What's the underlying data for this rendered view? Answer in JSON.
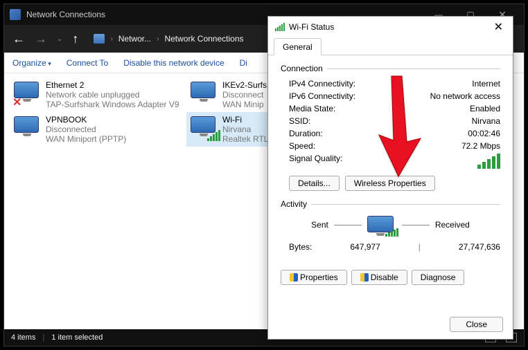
{
  "window": {
    "title": "Network Connections"
  },
  "breadcrumb": {
    "seg1": "Networ...",
    "seg2": "Network Connections"
  },
  "toolbar": {
    "organize": "Organize",
    "connect_to": "Connect To",
    "disable": "Disable this network device",
    "diagnose_label": "Di"
  },
  "connections": [
    {
      "name": "Ethernet 2",
      "status": "Network cable unplugged",
      "device": "TAP-Surfshark Windows Adapter V9"
    },
    {
      "name": "IKEv2-Surfs",
      "status": "Disconnect",
      "device": "WAN Minip"
    },
    {
      "name": "VPNBOOK",
      "status": "Disconnected",
      "device": "WAN Miniport (PPTP)"
    },
    {
      "name": "Wi-Fi",
      "status": "Nirvana",
      "device": "Realtek RTL"
    }
  ],
  "status": {
    "items": "4 items",
    "selected": "1 item selected"
  },
  "dialog": {
    "title": "Wi-Fi Status",
    "tab_general": "General",
    "group_connection": "Connection",
    "ipv4_label": "IPv4 Connectivity:",
    "ipv4_value": "Internet",
    "ipv6_label": "IPv6 Connectivity:",
    "ipv6_value": "No network access",
    "media_label": "Media State:",
    "media_value": "Enabled",
    "ssid_label": "SSID:",
    "ssid_value": "Nirvana",
    "duration_label": "Duration:",
    "duration_value": "00:02:46",
    "speed_label": "Speed:",
    "speed_value": "72.2 Mbps",
    "signal_label": "Signal Quality:",
    "details_btn": "Details...",
    "wireless_props_btn": "Wireless Properties",
    "group_activity": "Activity",
    "sent_label": "Sent",
    "received_label": "Received",
    "bytes_label": "Bytes:",
    "sent_bytes": "647,977",
    "recv_bytes": "27,747,636",
    "properties_btn": "Properties",
    "disable_btn": "Disable",
    "diagnose_btn": "Diagnose",
    "close_btn": "Close"
  }
}
